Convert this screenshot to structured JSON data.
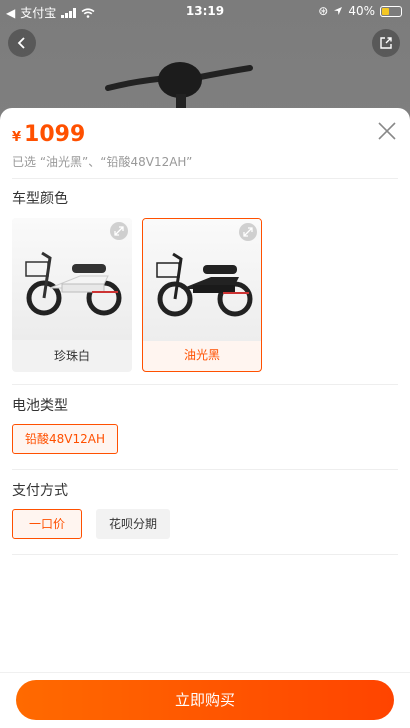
{
  "status_bar": {
    "back_app": "支付宝",
    "time": "13:19",
    "battery": "40%"
  },
  "icons": {
    "back": "chevron-left-icon",
    "share": "share-icon",
    "close": "close-icon",
    "expand": "expand-icon"
  },
  "sheet": {
    "currency": "¥",
    "price": "1099",
    "selected_text": "已选 “油光黑”、“铅酸48V12AH”",
    "color_section": {
      "title": "车型颜色",
      "options": [
        {
          "label": "珍珠白",
          "selected": false
        },
        {
          "label": "油光黑",
          "selected": true
        }
      ]
    },
    "battery_section": {
      "title": "电池类型",
      "options": [
        {
          "label": "铅酸48V12AH",
          "selected": true
        }
      ]
    },
    "payment_section": {
      "title": "支付方式",
      "options": [
        {
          "label": "一口价",
          "selected": true
        },
        {
          "label": "花呗分期",
          "selected": false
        }
      ]
    },
    "buy_button": "立即购买"
  },
  "colors": {
    "accent": "#ff5000",
    "selected_bg": "#fff5f0"
  }
}
